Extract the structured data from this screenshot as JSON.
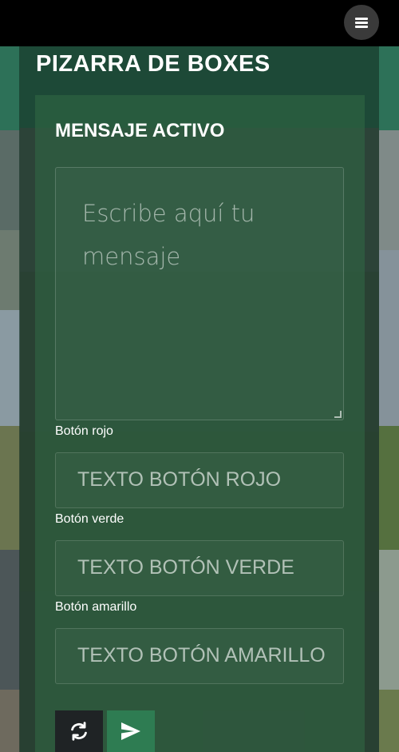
{
  "header": {
    "title": "PIZARRA DE BOXES",
    "menu_icon": "hamburger-menu-icon"
  },
  "panel": {
    "title": "MENSAJE ACTIVO",
    "message_placeholder": "Escribe aquí tu mensaje",
    "fields": [
      {
        "label": "Botón rojo",
        "placeholder": "TEXTO BOTÓN ROJO"
      },
      {
        "label": "Botón verde",
        "placeholder": "TEXTO BOTÓN VERDE"
      },
      {
        "label": "Botón amarillo",
        "placeholder": "TEXTO BOTÓN AMARILLO"
      }
    ],
    "actions": {
      "refresh_icon": "refresh-icon",
      "send_icon": "send-icon"
    }
  },
  "colors": {
    "top_bar": "#000000",
    "panel_green": "#326946",
    "send_button": "#2e7c52",
    "refresh_button": "#1f2325"
  }
}
